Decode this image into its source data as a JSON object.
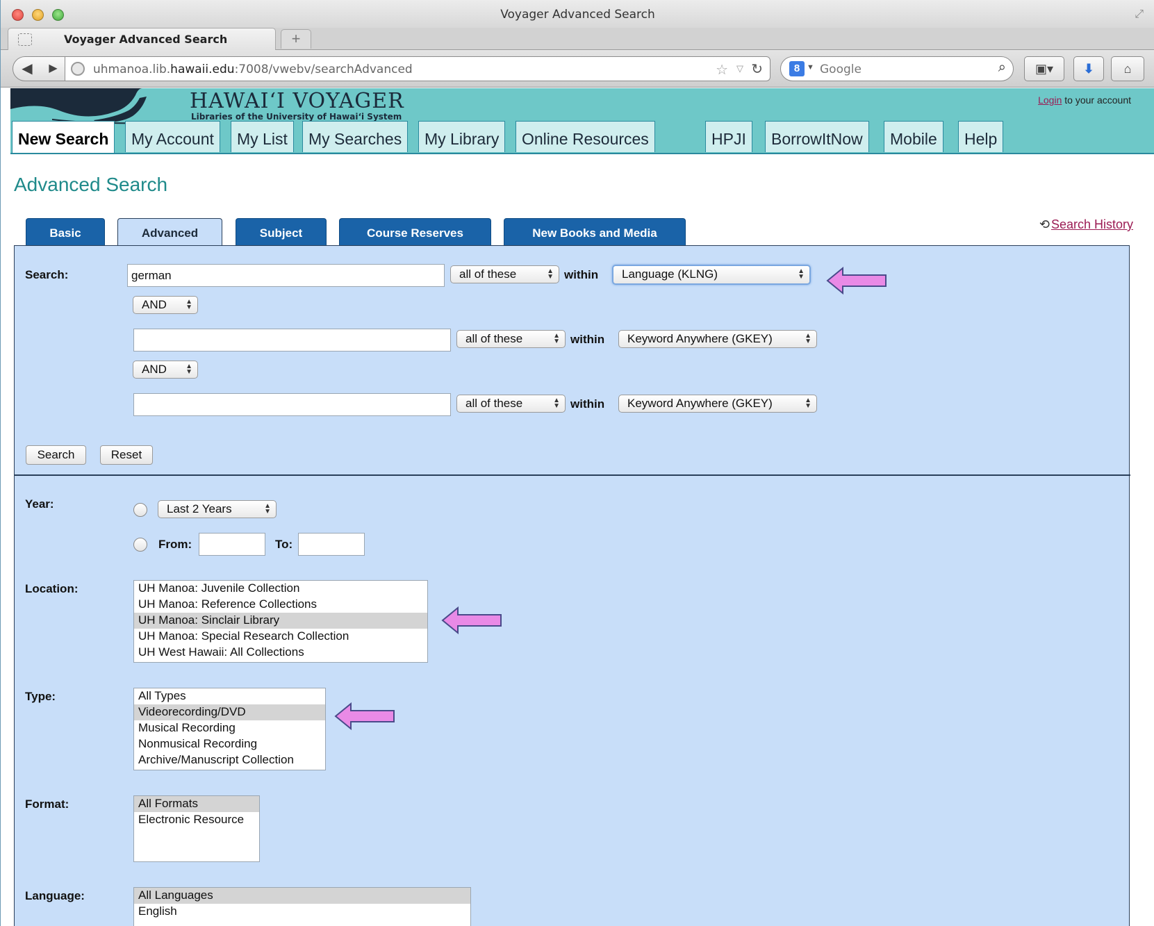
{
  "window": {
    "title": "Voyager Advanced Search",
    "tab_title": "Voyager Advanced Search",
    "new_tab_label": "+",
    "url_prefix": "uhmanoa.lib.",
    "url_domain": "hawaii.edu",
    "url_suffix": ":7008/vwebv/searchAdvanced",
    "search_engine_placeholder": "Google"
  },
  "site": {
    "title": "HAWAI‘I VOYAGER",
    "subtitle": "Libraries of the University of Hawai‘i System",
    "login_link": "Login",
    "login_suffix": " to your account"
  },
  "nav_tabs": [
    {
      "label": "New Search",
      "active": true
    },
    {
      "label": "My Account"
    },
    {
      "label": "My List"
    },
    {
      "label": "My Searches"
    },
    {
      "label": "My Library"
    },
    {
      "label": "Online Resources"
    },
    {
      "label": "HPJI"
    },
    {
      "label": "BorrowItNow"
    },
    {
      "label": "Mobile"
    },
    {
      "label": "Help"
    }
  ],
  "page": {
    "heading": "Advanced Search",
    "search_history": "Search History"
  },
  "search_tabs": [
    {
      "label": "Basic"
    },
    {
      "label": "Advanced",
      "active": true
    },
    {
      "label": "Subject"
    },
    {
      "label": "Course Reserves"
    },
    {
      "label": "New Books and Media"
    }
  ],
  "search_form": {
    "label": "Search:",
    "within_label": "within",
    "rows": [
      {
        "value": "german",
        "match": "all of these",
        "index": "Language (KLNG)"
      },
      {
        "value": "",
        "match": "all of these",
        "index": "Keyword Anywhere (GKEY)"
      },
      {
        "value": "",
        "match": "all of these",
        "index": "Keyword Anywhere (GKEY)"
      }
    ],
    "operators": [
      "AND",
      "AND"
    ],
    "search_button": "Search",
    "reset_button": "Reset"
  },
  "year": {
    "label": "Year:",
    "preset": "Last 2 Years",
    "from_label": "From:",
    "to_label": "To:"
  },
  "location": {
    "label": "Location:",
    "items": [
      "UH Manoa: Juvenile Collection",
      "UH Manoa: Reference Collections",
      "UH Manoa: Sinclair Library",
      "UH Manoa: Special Research Collection",
      "UH West Hawaii: All Collections"
    ],
    "selected": "UH Manoa: Sinclair Library"
  },
  "type": {
    "label": "Type:",
    "items": [
      "All Types",
      "Videorecording/DVD",
      "Musical Recording",
      "Nonmusical Recording",
      "Archive/Manuscript Collection"
    ],
    "selected": "Videorecording/DVD"
  },
  "format": {
    "label": "Format:",
    "items": [
      "All Formats",
      "Electronic Resource"
    ],
    "selected": "All Formats"
  },
  "language": {
    "label": "Language:",
    "items": [
      "All Languages",
      "English"
    ],
    "selected": "All Languages"
  },
  "colors": {
    "header_teal": "#6ec8c8",
    "panel_blue": "#c8def9",
    "tab_blue": "#1a63a8",
    "heading_teal": "#1f8a8a",
    "link_maroon": "#9b1b53",
    "arrow_pink": "#e98ae6"
  },
  "icons": [
    "close-icon",
    "minimize-icon",
    "zoom-icon",
    "fullscreen-icon",
    "back-icon",
    "forward-icon",
    "globe-icon",
    "star-icon",
    "reload-icon",
    "google-icon",
    "magnifier-icon",
    "bookmarks-icon",
    "download-icon",
    "home-icon",
    "history-icon",
    "arrow-annotation-icon"
  ]
}
